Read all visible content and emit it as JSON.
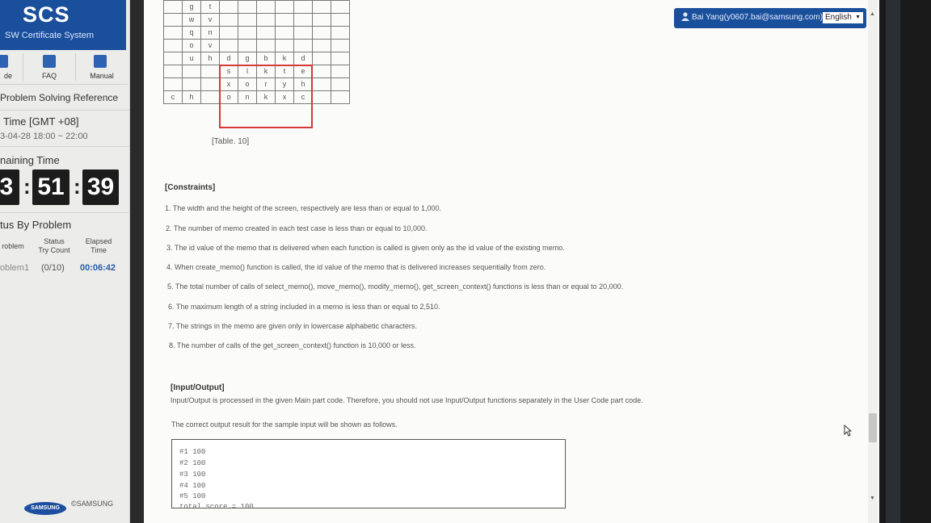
{
  "sidebar": {
    "logo_title": "SCS",
    "logo_subtitle": "SW Certificate System",
    "nav": [
      {
        "label": "de",
        "icon": "code-icon"
      },
      {
        "label": "FAQ",
        "icon": "faq-icon"
      },
      {
        "label": "Manual",
        "icon": "manual-icon"
      }
    ],
    "reference_link": "Problem Solving Reference",
    "time_label": ". Time [GMT +08]",
    "time_range": "3-04-28 18:00 ~ 22:00",
    "remaining_label": "naining Time",
    "remaining": {
      "hours": "3",
      "minutes": "51",
      "seconds": "39"
    },
    "status_title": "tus By Problem",
    "status_columns": {
      "problem": "roblem",
      "try_count_1": "Status",
      "try_count_2": "Try Count",
      "elapsed_1": "Elapsed",
      "elapsed_2": "Time"
    },
    "status_row": {
      "problem": "oblem1",
      "try_count": "(0/10)",
      "elapsed": "00:06:42"
    },
    "samsung_badge": "SAMSUNG",
    "samsung_copy": "©SAMSUNG"
  },
  "user_bar": {
    "user": "Bai Yang(y0607.bai@samsung.com)",
    "language": "English"
  },
  "grid": {
    "rows": [
      [
        "",
        "g",
        "t",
        "",
        "",
        "",
        "",
        "",
        "",
        ""
      ],
      [
        "",
        "w",
        "v",
        "",
        "",
        "",
        "",
        "",
        "",
        ""
      ],
      [
        "",
        "q",
        "n",
        "",
        "",
        "",
        "",
        "",
        "",
        ""
      ],
      [
        "",
        "o",
        "v",
        "",
        "",
        "",
        "",
        "",
        "",
        ""
      ],
      [
        "",
        "u",
        "h",
        "d",
        "g",
        "b",
        "k",
        "d",
        "",
        ""
      ],
      [
        "",
        "",
        "",
        "s",
        "l",
        "k",
        "t",
        "e",
        "",
        ""
      ],
      [
        "",
        "",
        "",
        "x",
        "o",
        "r",
        "y",
        "h",
        "",
        ""
      ],
      [
        "c",
        "h",
        "",
        "o",
        "n",
        "k",
        "x",
        "c",
        "",
        ""
      ]
    ],
    "caption": "[Table. 10]"
  },
  "constraints": {
    "heading": "[Constraints]",
    "items": [
      "1. The width and the height of the screen, respectively are less than or equal to 1,000.",
      "2. The number of memo created in each test case is less than or equal to 10,000.",
      "3. The id value of the memo that is delivered when each function is called is given only as the id value of the existing memo.",
      "4. When create_memo() function is called, the id value of the memo that is delivered increases sequentially from zero.",
      "5. The total number of calls of select_memo(), move_memo(), modify_memo(), get_screen_context() functions is less than or equal to 20,000.",
      "6. The maximum length of a string included in a memo is less than or equal to 2,510.",
      "7. The strings in the memo are given only in lowercase alphabetic characters.",
      "8. The number of calls of the get_screen_context() function is 10,000 or less."
    ]
  },
  "io": {
    "heading": "[Input/Output]",
    "line1": "Input/Output is processed in the given Main part code. Therefore, you should not use Input/Output functions separately in the User Code part code.",
    "line2": "The correct output result for the sample input will be shown as follows.",
    "output": [
      "#1 100",
      "#2 100",
      "#3 100",
      "#4 100",
      "#5 100",
      "total score = 100"
    ]
  },
  "colors": {
    "brand": "#1a4f9c",
    "highlight": "#d43a3a",
    "timer": "#1c1c1c"
  }
}
